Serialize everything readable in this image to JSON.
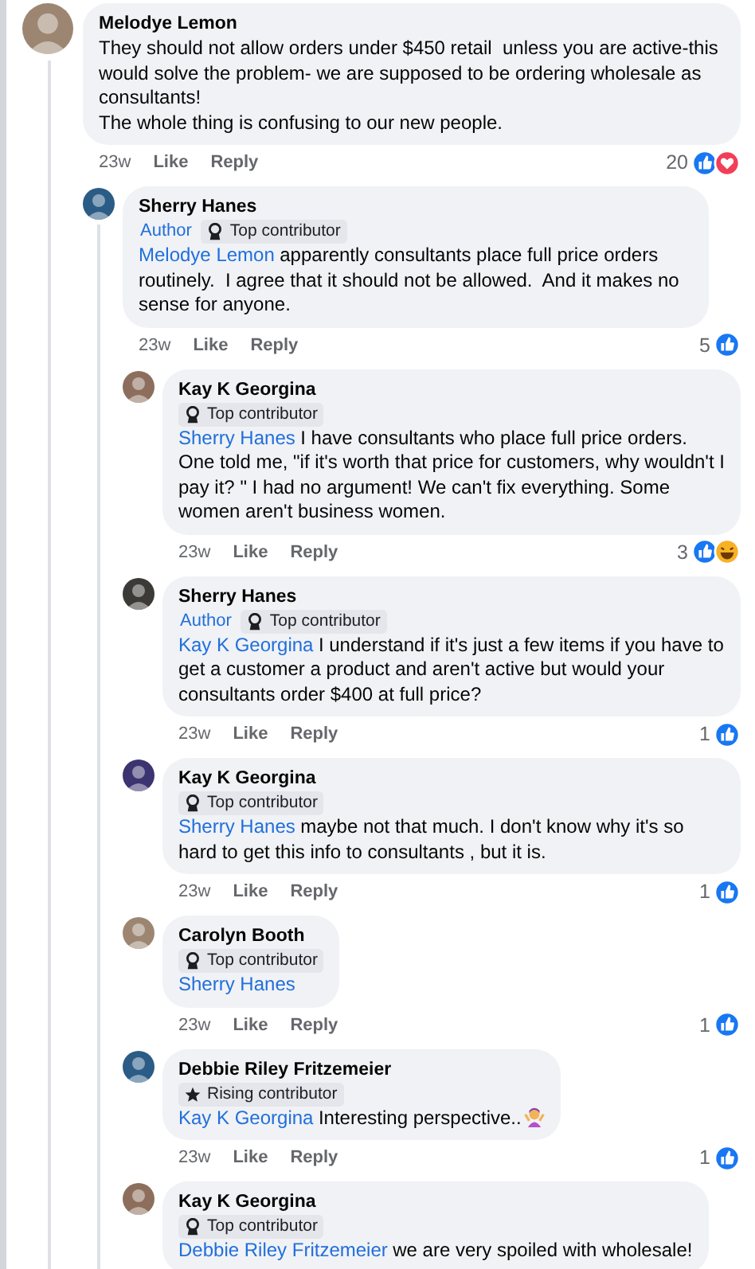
{
  "comments": [
    {
      "author": "Melodye Lemon",
      "text": "They should not allow orders under $450 retail  unless you are active-this would solve the problem- we are supposed to be ordering wholesale as consultants!\nThe whole thing is confusing to our new people.",
      "time": "23w",
      "actions": [
        "Like",
        "Reply"
      ],
      "reaction_count": "20",
      "reactions": [
        {
          "kind": "like"
        },
        {
          "kind": "love"
        }
      ],
      "replies": [
        {
          "author": "Sherry Hanes",
          "badges": [
            {
              "kind": "author",
              "label": "Author"
            },
            {
              "kind": "top",
              "label": "Top contributor"
            }
          ],
          "mention": "Melodye Lemon",
          "text": "apparently consultants place full price orders routinely.  I agree that it should not be allowed.  And it makes no sense for anyone.",
          "time": "23w",
          "actions": [
            "Like",
            "Reply"
          ],
          "reaction_count": "5",
          "reactions": [
            {
              "kind": "like"
            }
          ],
          "replies": [
            {
              "author": "Kay K Georgina",
              "badges": [
                {
                  "kind": "top",
                  "label": "Top contributor"
                }
              ],
              "mention": "Sherry Hanes",
              "text": "I have consultants who place full price orders. One told me, \"if it's worth that price for customers, why wouldn't I pay it? \" I had no argument! We can't fix everything. Some women aren't business women.",
              "time": "23w",
              "actions": [
                "Like",
                "Reply"
              ],
              "reaction_count": "3",
              "reactions": [
                {
                  "kind": "like"
                },
                {
                  "kind": "haha"
                }
              ]
            },
            {
              "author": "Sherry Hanes",
              "badges": [
                {
                  "kind": "author",
                  "label": "Author"
                },
                {
                  "kind": "top",
                  "label": "Top contributor"
                }
              ],
              "mention": "Kay K Georgina",
              "text": "I understand if it's just a few items if you have to get a customer a product and aren't active but would your consultants order $400 at full price?",
              "time": "23w",
              "actions": [
                "Like",
                "Reply"
              ],
              "reaction_count": "1",
              "reactions": [
                {
                  "kind": "like"
                }
              ]
            },
            {
              "author": "Kay K Georgina",
              "badges": [
                {
                  "kind": "top",
                  "label": "Top contributor"
                }
              ],
              "mention": "Sherry Hanes",
              "text": "maybe not that much. I don't know why it's so hard to get this info to consultants , but it is.",
              "time": "23w",
              "actions": [
                "Like",
                "Reply"
              ],
              "reaction_count": "1",
              "reactions": [
                {
                  "kind": "like"
                }
              ]
            },
            {
              "author": "Carolyn Booth",
              "badges": [
                {
                  "kind": "top",
                  "label": "Top contributor"
                }
              ],
              "mention": "Sherry Hanes",
              "time": "23w",
              "actions": [
                "Like",
                "Reply"
              ],
              "reaction_count": "1",
              "reactions": [
                {
                  "kind": "like"
                }
              ]
            },
            {
              "author": "Debbie Riley Fritzemeier",
              "badges": [
                {
                  "kind": "rising",
                  "label": "Rising contributor"
                }
              ],
              "mention": "Kay K Georgina",
              "text": "Interesting perspective..",
              "emoji": {
                "kind": "shrug"
              },
              "time": "23w",
              "actions": [
                "Like",
                "Reply"
              ],
              "reaction_count": "1",
              "reactions": [
                {
                  "kind": "like"
                }
              ]
            },
            {
              "author": "Kay K Georgina",
              "badges": [
                {
                  "kind": "top",
                  "label": "Top contributor"
                }
              ],
              "mention": "Debbie Riley Fritzemeier",
              "text": "we are very spoiled with wholesale!"
            }
          ]
        }
      ]
    }
  ]
}
